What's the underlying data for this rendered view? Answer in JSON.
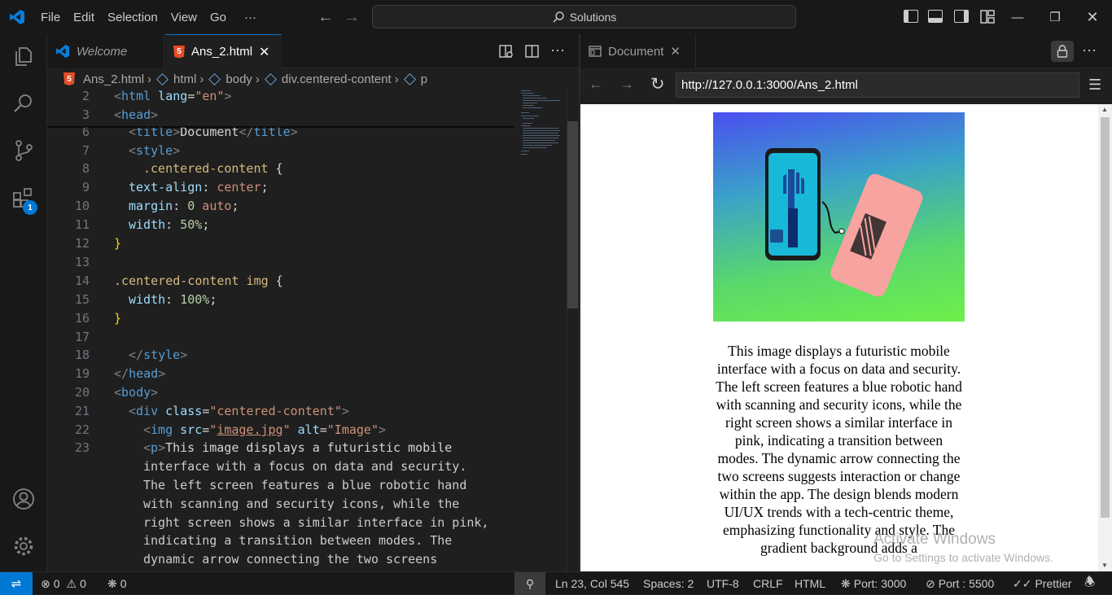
{
  "menu": [
    "File",
    "Edit",
    "Selection",
    "View",
    "Go",
    "···"
  ],
  "command_center": {
    "label": "Solutions"
  },
  "editor": {
    "tabs": [
      {
        "label": "Welcome"
      },
      {
        "label": "Ans_2.html"
      }
    ],
    "breadcrumb": [
      "Ans_2.html",
      "html",
      "body",
      "div.centered-content",
      "p"
    ],
    "line_numbers": [
      "2",
      "3",
      "6",
      "7",
      "8",
      "9",
      "10",
      "11",
      "12",
      "13",
      "14",
      "15",
      "16",
      "17",
      "18",
      "19",
      "20",
      "21",
      "22",
      "23",
      "",
      "",
      "",
      "",
      "",
      ""
    ]
  },
  "code": {
    "l2": {
      "a": "<",
      "b": "html",
      "c": " lang",
      "d": "=",
      "e": "\"en\"",
      "f": ">"
    },
    "l3": {
      "a": "<",
      "b": "head",
      "c": ">"
    },
    "l6": {
      "a": "<",
      "b": "title",
      "c": ">",
      "d": "Document",
      "e": "</",
      "f": "title",
      "g": ">"
    },
    "l7": {
      "a": "<",
      "b": "style",
      "c": ">"
    },
    "l8": {
      "a": ".centered-content",
      "b": " {"
    },
    "l9": {
      "a": "text-align",
      "b": ": ",
      "c": "center",
      "d": ";"
    },
    "l10": {
      "a": "margin",
      "b": ": ",
      "c": "0",
      "d": " auto",
      "e": ";"
    },
    "l11": {
      "a": "width",
      "b": ": ",
      "c": "50%",
      "d": ";"
    },
    "l12": "}",
    "l14": {
      "a": ".centered-content img",
      "b": " {"
    },
    "l15": {
      "a": "width",
      "b": ": ",
      "c": "100%",
      "d": ";"
    },
    "l16": "}",
    "l18": {
      "a": "</",
      "b": "style",
      "c": ">"
    },
    "l19": {
      "a": "</",
      "b": "head",
      "c": ">"
    },
    "l20": {
      "a": "<",
      "b": "body",
      "c": ">"
    },
    "l21": {
      "a": "<",
      "b": "div",
      "c": " class",
      "d": "=",
      "e": "\"centered-content\"",
      "f": ">"
    },
    "l22": {
      "a": "<",
      "b": "img",
      "c": " src",
      "d": "=",
      "e": "\"",
      "f": "image.jpg",
      "g": "\"",
      "h": " alt",
      "i": "=",
      "j": "\"Image\"",
      "k": ">"
    },
    "l23": {
      "a": "<",
      "b": "p",
      "c": ">",
      "d": "This image displays a futuristic mobile"
    },
    "w1": "interface with a focus on data and security.",
    "w2": "The left screen features a blue robotic hand",
    "w3": "with scanning and security icons, while the",
    "w4": "right screen shows a similar interface in pink,",
    "w5": "indicating a transition between modes. The",
    "w6": "dynamic arrow connecting the two screens"
  },
  "preview": {
    "tab_label": "Document",
    "url": "http://127.0.0.1:3000/Ans_2.html",
    "paragraph": "This image displays a futuristic mobile interface with a focus on data and security. The left screen features a blue robotic hand with scanning and security icons, while the right screen shows a similar interface in pink, indicating a transition between modes. The dynamic arrow connecting the two screens suggests interaction or change within the app. The design blends modern UI/UX trends with a tech-centric theme, emphasizing functionality and style. The gradient background adds a"
  },
  "watermark": {
    "title": "Activate Windows",
    "subtitle": "Go to Settings to activate Windows."
  },
  "status": {
    "errors": "0",
    "warnings": "0",
    "ports": "0",
    "cursor": "Ln 23, Col 545",
    "spaces": "Spaces: 2",
    "encoding": "UTF-8",
    "eol": "CRLF",
    "language": "HTML",
    "port1": "Port: 3000",
    "port2": "Port : 5500",
    "prettier": "Prettier"
  },
  "colors": {
    "accent": "#0078d4",
    "html_icon": "#e44d26"
  }
}
